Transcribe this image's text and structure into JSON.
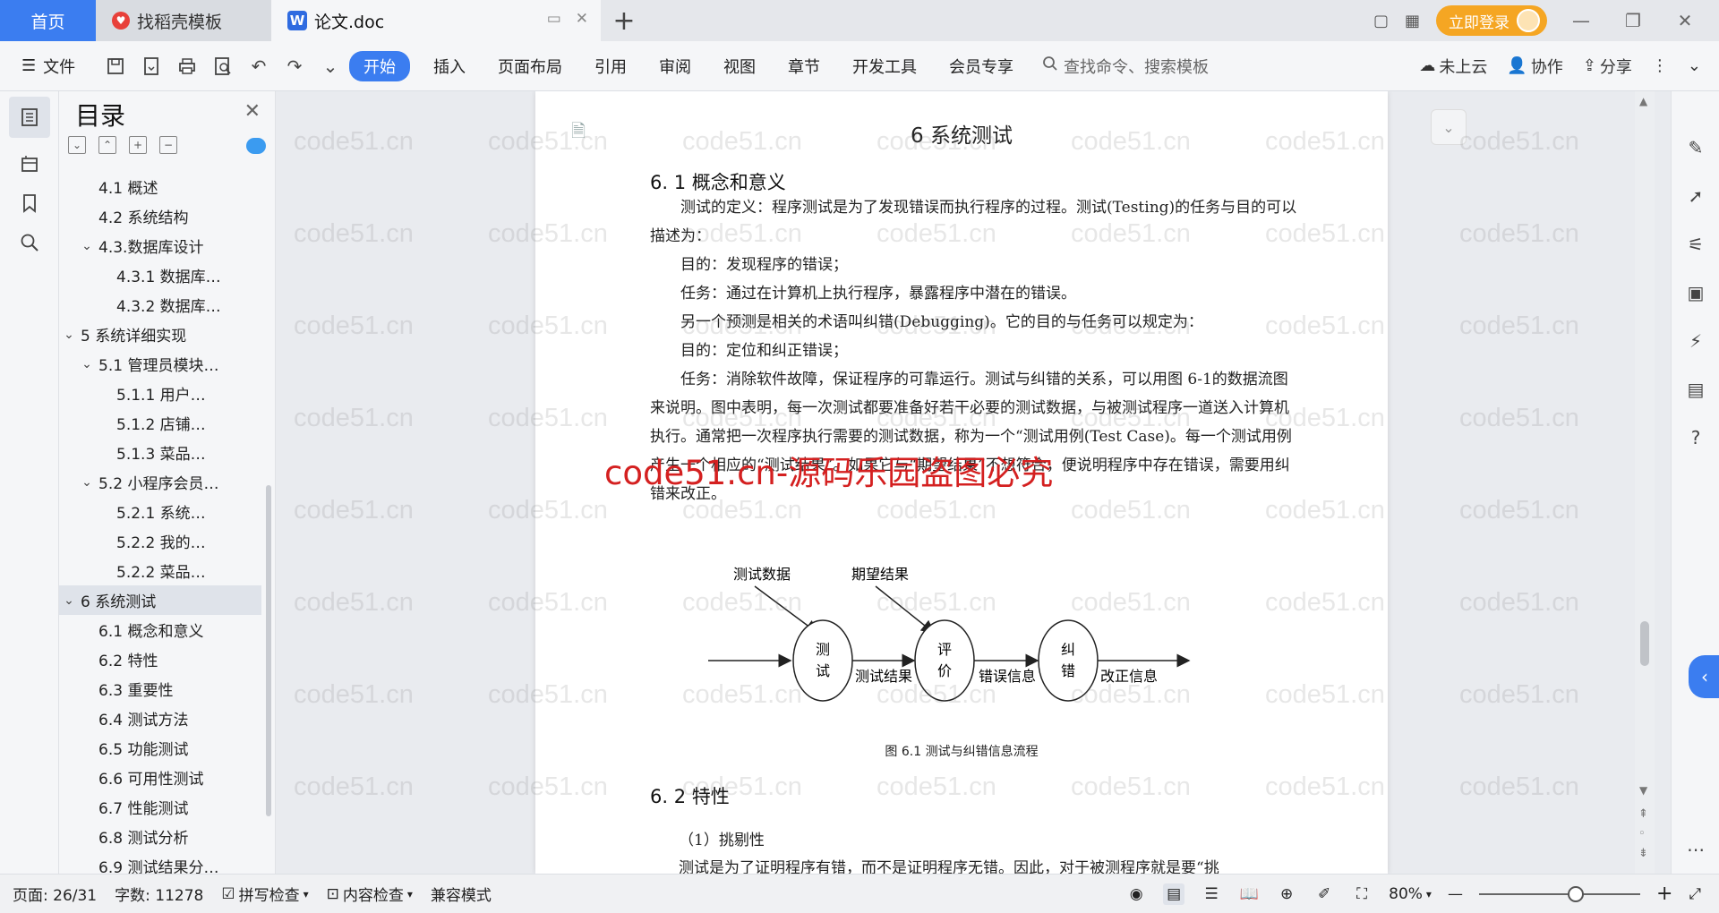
{
  "titlebar": {
    "tabs": [
      {
        "label": "首页",
        "type": "home"
      },
      {
        "label": "找稻壳模板",
        "type": "plain"
      },
      {
        "label": "论文.doc",
        "type": "active"
      }
    ],
    "login_label": "立即登录"
  },
  "ribbon": {
    "file_label": "文件",
    "menu": [
      "开始",
      "插入",
      "页面布局",
      "引用",
      "审阅",
      "视图",
      "章节",
      "开发工具",
      "会员专享"
    ],
    "active_menu": "开始",
    "search_placeholder": "查找命令、搜索模板",
    "right": [
      "未上云",
      "协作",
      "分享"
    ]
  },
  "toc": {
    "title": "目录",
    "items": [
      {
        "label": "4.1 概述",
        "level": 2,
        "toggle": ""
      },
      {
        "label": "4.2 系统结构",
        "level": 2,
        "toggle": ""
      },
      {
        "label": "4.3.数据库设计",
        "level": 2,
        "toggle": "v"
      },
      {
        "label": "4.3.1 数据库…",
        "level": 3,
        "toggle": ""
      },
      {
        "label": "4.3.2 数据库…",
        "level": 3,
        "toggle": ""
      },
      {
        "label": "5 系统详细实现",
        "level": 1,
        "toggle": "v"
      },
      {
        "label": "5.1 管理员模块…",
        "level": 2,
        "toggle": "v"
      },
      {
        "label": "5.1.1 用户…",
        "level": 3,
        "toggle": ""
      },
      {
        "label": "5.1.2 店铺…",
        "level": 3,
        "toggle": ""
      },
      {
        "label": "5.1.3 菜品…",
        "level": 3,
        "toggle": ""
      },
      {
        "label": "5.2 小程序会员…",
        "level": 2,
        "toggle": "v"
      },
      {
        "label": "5.2.1 系统…",
        "level": 3,
        "toggle": ""
      },
      {
        "label": "5.2.2 我的…",
        "level": 3,
        "toggle": ""
      },
      {
        "label": "5.2.2 菜品…",
        "level": 3,
        "toggle": ""
      },
      {
        "label": "6 系统测试",
        "level": 1,
        "toggle": "v",
        "active": true
      },
      {
        "label": "6.1 概念和意义",
        "level": 2,
        "toggle": ""
      },
      {
        "label": "6.2 特性",
        "level": 2,
        "toggle": ""
      },
      {
        "label": "6.3 重要性",
        "level": 2,
        "toggle": ""
      },
      {
        "label": "6.4 测试方法",
        "level": 2,
        "toggle": ""
      },
      {
        "label": "6.5  功能测试",
        "level": 2,
        "toggle": ""
      },
      {
        "label": "6.6 可用性测试",
        "level": 2,
        "toggle": ""
      },
      {
        "label": "6.7 性能测试",
        "level": 2,
        "toggle": ""
      },
      {
        "label": "6.8 测试分析",
        "level": 2,
        "toggle": ""
      },
      {
        "label": "6.9 测试结果分…",
        "level": 2,
        "toggle": ""
      }
    ]
  },
  "document": {
    "chapter_title": "6 系统测试",
    "section1_title": "6. 1 概念和意义",
    "paragraphs": [
      {
        "text": "测试的定义：程序测试是为了发现错误而执行程序的过程。测试(Testing)的任务与目的可以描述为：",
        "indent": true
      },
      {
        "text": "目的：发现程序的错误；",
        "indent": true
      },
      {
        "text": "任务：通过在计算机上执行程序，暴露程序中潜在的错误。",
        "indent": true
      },
      {
        "text": "另一个预测是相关的术语叫纠错(Debugging)。它的目的与任务可以规定为：",
        "indent": true
      },
      {
        "text": "目的：定位和纠正错误；",
        "indent": true
      },
      {
        "text": "任务：消除软件故障，保证程序的可靠运行。测试与纠错的关系，可以用图 6-1的数据流图来说明。图中表明，每一次测试都要准备好若干必要的测试数据，与被测试程序一道送入计算机执行。通常把一次程序执行需要的测试数据，称为一个“测试用例(Test Case)。每一个测试用例产生一个相应的“测试结果”。如果它与“期望结果”不想符合，便说明程序中存在错误，需要用纠错来改正。",
        "indent": true
      }
    ],
    "diagram": {
      "input_top_left": "测试数据",
      "input_top_right": "期望结果",
      "nodes": [
        [
          "测",
          "试"
        ],
        [
          "评",
          "价"
        ],
        [
          "纠",
          "错"
        ]
      ],
      "edge_labels": [
        "测试结果",
        "错误信息",
        "改正信息"
      ]
    },
    "figure_caption": "图 6.1 测试与纠错信息流程",
    "section2_title": "6. 2 特性",
    "section2_item": "（1）挑剔性",
    "section2_partial": "测试是为了证明程序有错，而不是证明程序无错。因此，对于被测程序就是要“挑"
  },
  "watermark_text": "code51.cn",
  "red_watermark": "code51.cn-源码乐园盗图必究",
  "statusbar": {
    "page": "页面: 26/31",
    "words": "字数: 11278",
    "spell": "拼写检查",
    "content_check": "内容检查",
    "compat": "兼容模式",
    "zoom": "80%",
    "zoom_level": 0.6
  },
  "colors": {
    "accent": "#3b7df0",
    "login": "#f5a623",
    "red_watermark": "#d42020"
  }
}
